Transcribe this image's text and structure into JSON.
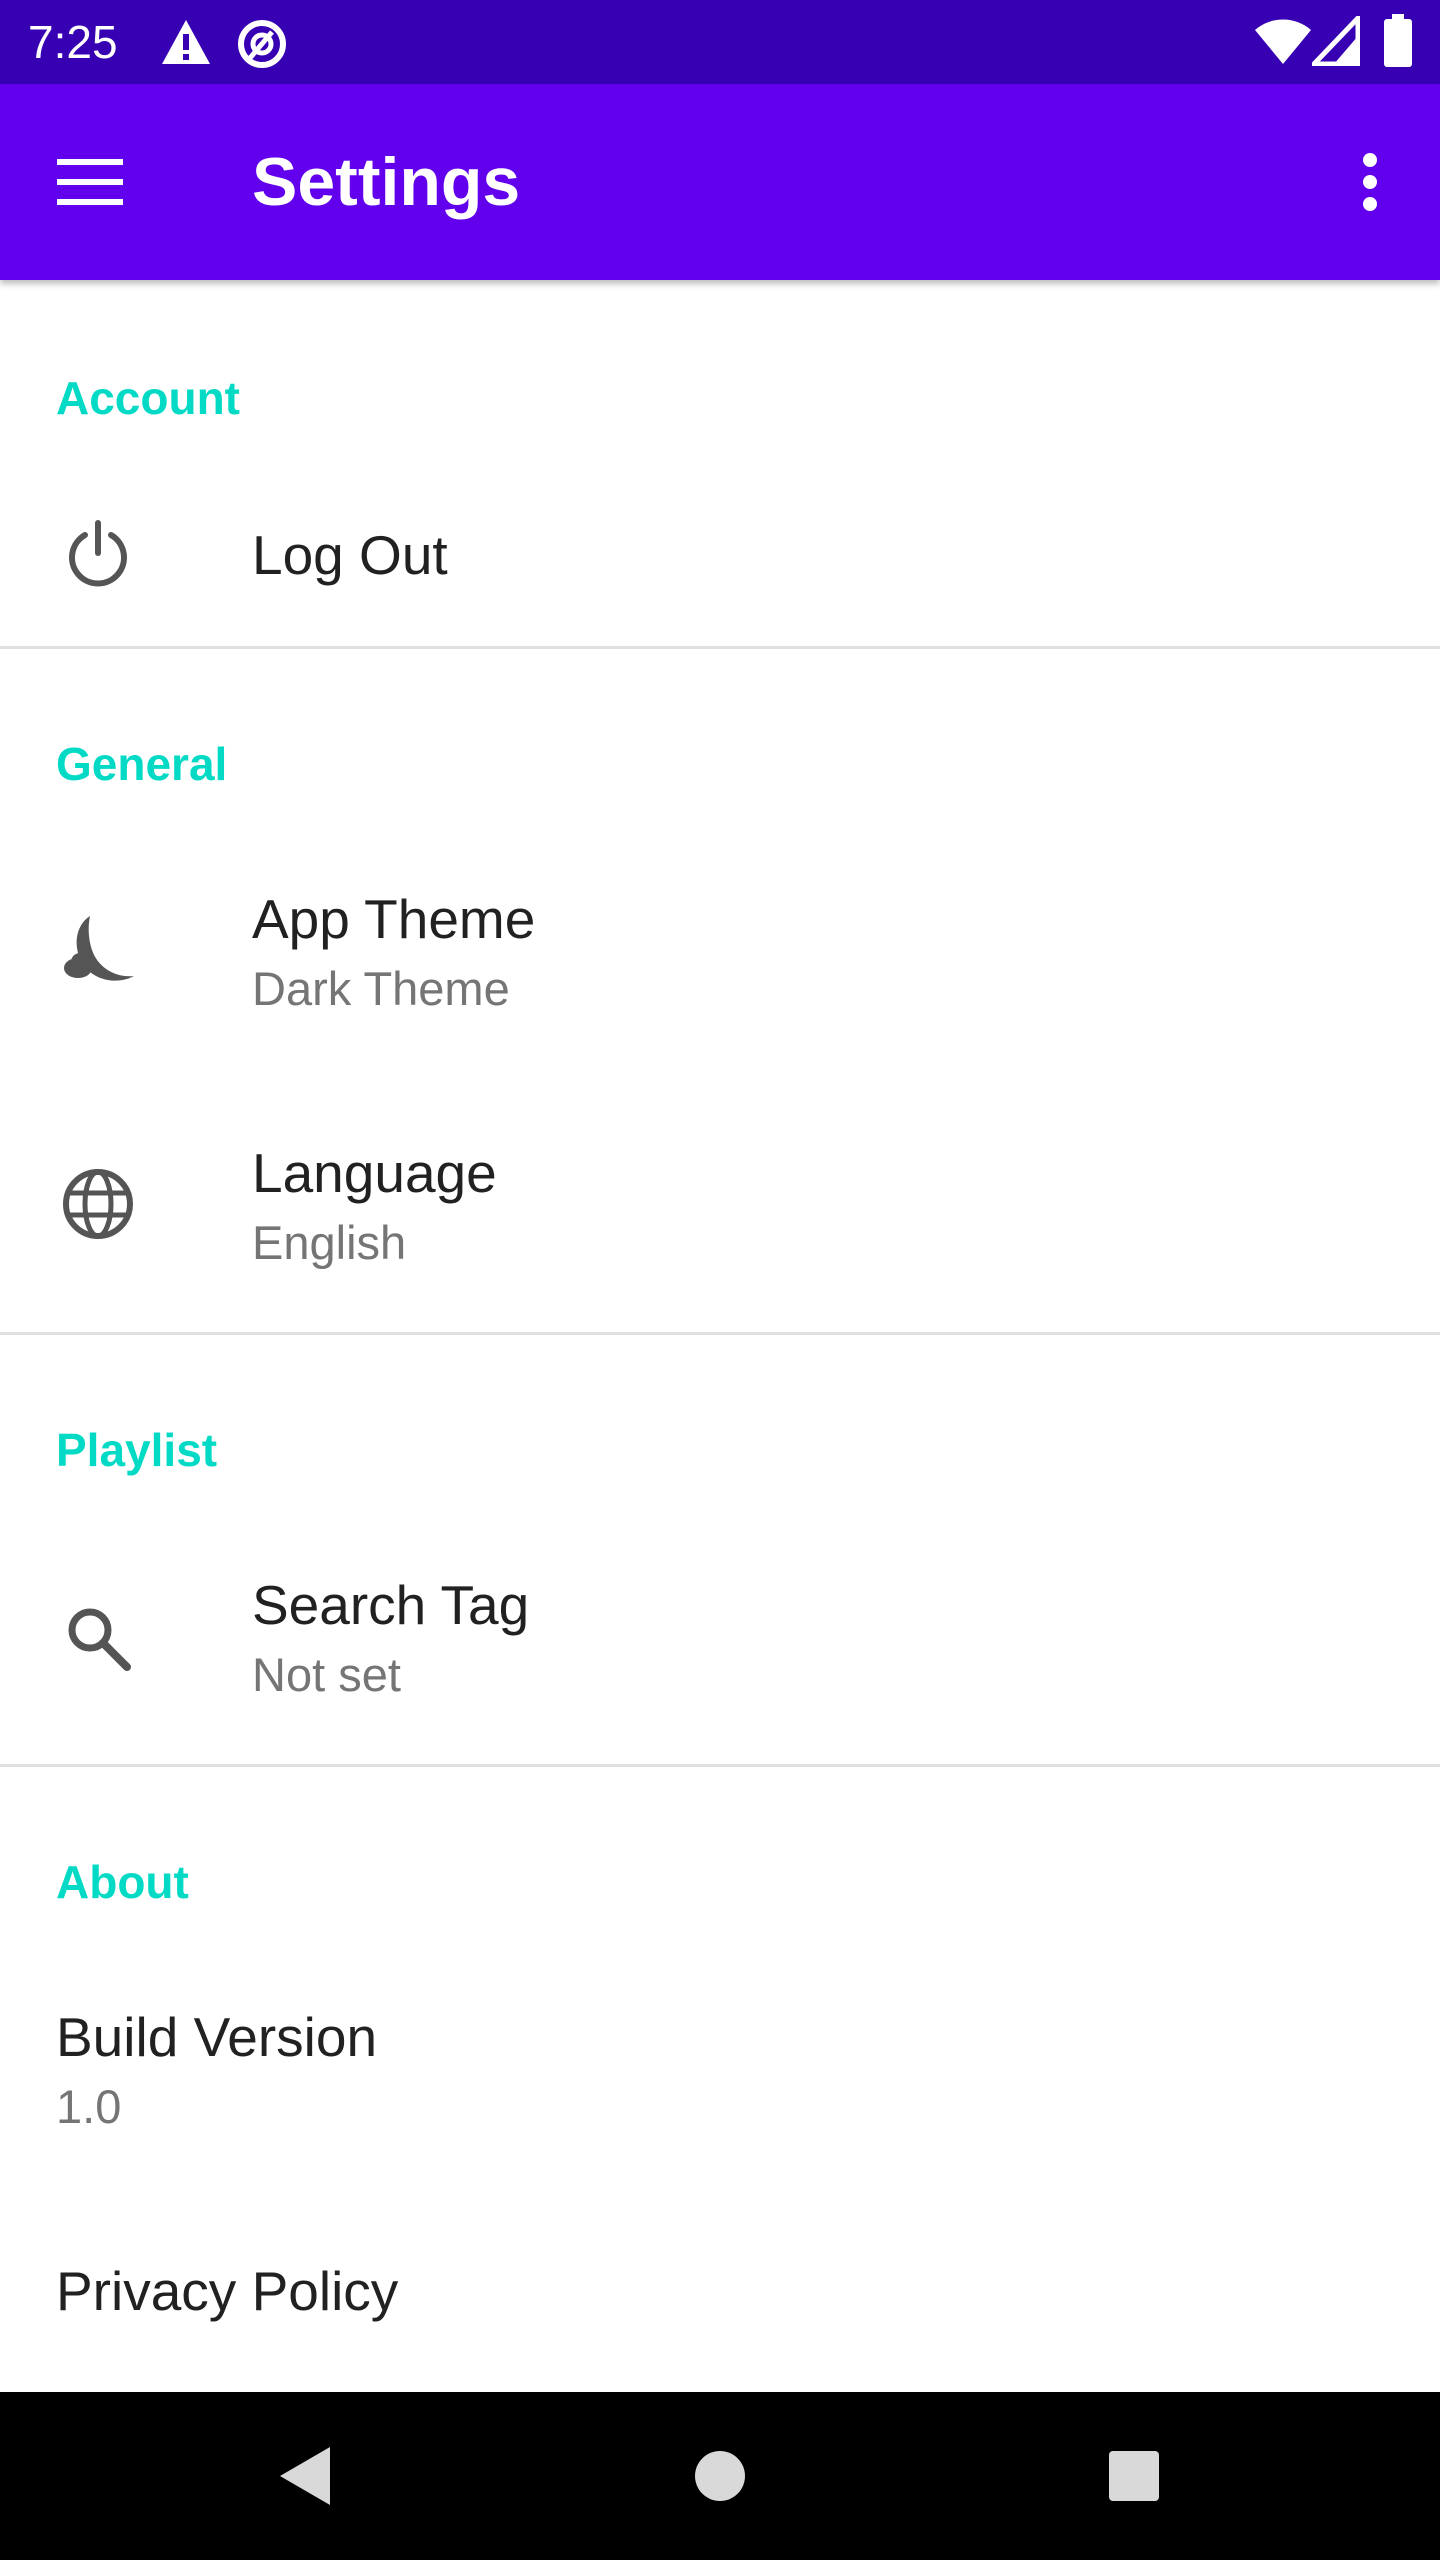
{
  "status_bar": {
    "time": "7:25",
    "icons": [
      "warning-icon",
      "at-sign-icon",
      "wifi-icon",
      "signal-icon",
      "battery-icon"
    ],
    "background": "#3700b3"
  },
  "app_bar": {
    "title": "Settings",
    "background": "#6200ee",
    "left_icon": "hamburger-menu-icon",
    "right_icon": "more-vert-icon"
  },
  "accent_color": "#03dac5",
  "sections": [
    {
      "header": "Account",
      "items": [
        {
          "icon": "power-icon",
          "title": "Log Out"
        }
      ]
    },
    {
      "header": "General",
      "items": [
        {
          "icon": "moon-icon",
          "title": "App Theme",
          "summary": "Dark Theme"
        },
        {
          "icon": "globe-icon",
          "title": "Language",
          "summary": "English"
        }
      ]
    },
    {
      "header": "Playlist",
      "items": [
        {
          "icon": "search-icon",
          "title": "Search Tag",
          "summary": "Not set"
        }
      ]
    },
    {
      "header": "About",
      "items": [
        {
          "title": "Build Version",
          "summary": "1.0"
        },
        {
          "title": "Privacy Policy"
        }
      ]
    }
  ],
  "nav_bar": {
    "buttons": [
      "back-icon",
      "home-icon",
      "recents-icon"
    ]
  }
}
